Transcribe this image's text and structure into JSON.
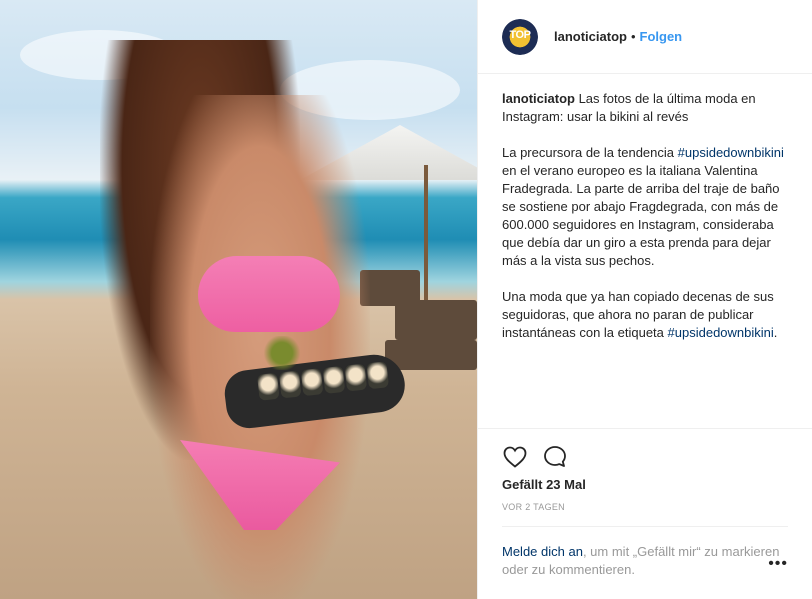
{
  "post": {
    "username": "lanoticiatop",
    "separator": "•",
    "follow_label": "Folgen",
    "avatar_text": "TOP",
    "caption": {
      "user": "lanoticiatop",
      "intro": "Las fotos de la última moda en Instagram: usar la bikini al revés",
      "p1_before": "La precursora de la tendencia",
      "p1_hashtag": "#upsidedownbikini",
      "p1_after": "en el verano europeo es la italiana Valentina Fradegrada. La parte de arriba del traje de baño se sostiene por abajo Fragdegrada, con más de 600.000 seguidores en Instagram, consideraba que debía dar un giro a esta prenda para dejar más a la vista sus pechos.",
      "p2_text": "Una moda que ya han copiado decenas de sus seguidoras, que ahora no paran de publicar instantáneas con la etiqueta",
      "p2_hashtag": "#upsidedownbikini",
      "p2_end": "."
    },
    "likes": "Gefällt 23 Mal",
    "time": "VOR 2 TAGEN",
    "login": {
      "link": "Melde dich an",
      "rest": ", um mit „Gefällt mir“ zu markieren oder zu kommentieren."
    },
    "more_label": "•••"
  },
  "icons": {
    "like": "heart-icon",
    "comment": "comment-icon",
    "more": "more-options-icon"
  },
  "colors": {
    "link_blue": "#3897f0",
    "hashtag": "#003569",
    "muted": "#999999",
    "bikini_pink": "#ee5fa2"
  }
}
